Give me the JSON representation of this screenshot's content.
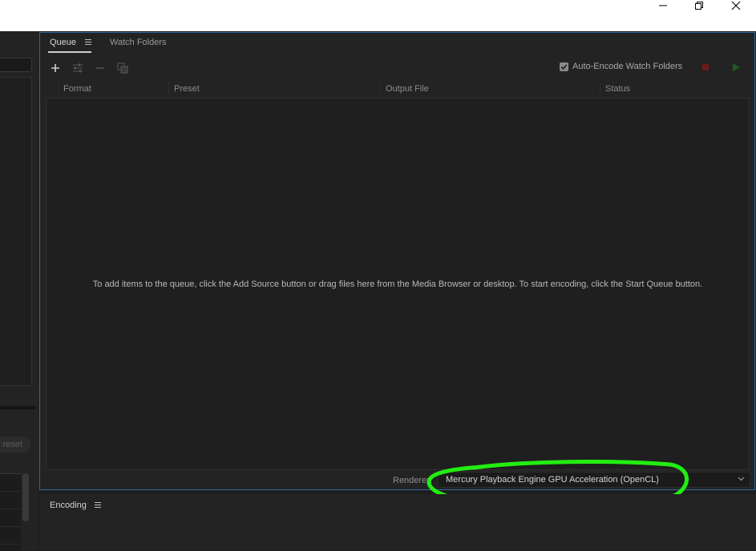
{
  "window": {
    "minimize_icon": "minimize-icon",
    "restore_icon": "restore-icon",
    "close_icon": "close-icon"
  },
  "left": {
    "preset_button_partial": "reset"
  },
  "queue": {
    "tabs": [
      {
        "label": "Queue",
        "active": true
      },
      {
        "label": "Watch Folders",
        "active": false
      }
    ],
    "toolbar": {
      "icons": [
        "add-source-icon",
        "settings-sliders-icon",
        "remove-icon",
        "duplicate-icon"
      ],
      "auto_encode_label": "Auto-Encode Watch Folders",
      "auto_encode_checked": true
    },
    "columns": [
      "Format",
      "Preset",
      "Output File",
      "Status"
    ],
    "empty_message": "To add items to the queue, click the Add Source button or drag files here from the Media Browser or desktop.  To start encoding, click the Start Queue button.",
    "renderer_label": "Renderer:",
    "renderer_value": "Mercury Playback Engine GPU Acceleration (OpenCL)"
  },
  "colors": {
    "panel_border": "#2f6a9e",
    "highlight": "#22ee11",
    "stop": "#6b1b1b",
    "play": "#1e5c1e"
  },
  "encoding": {
    "title": "Encoding"
  }
}
